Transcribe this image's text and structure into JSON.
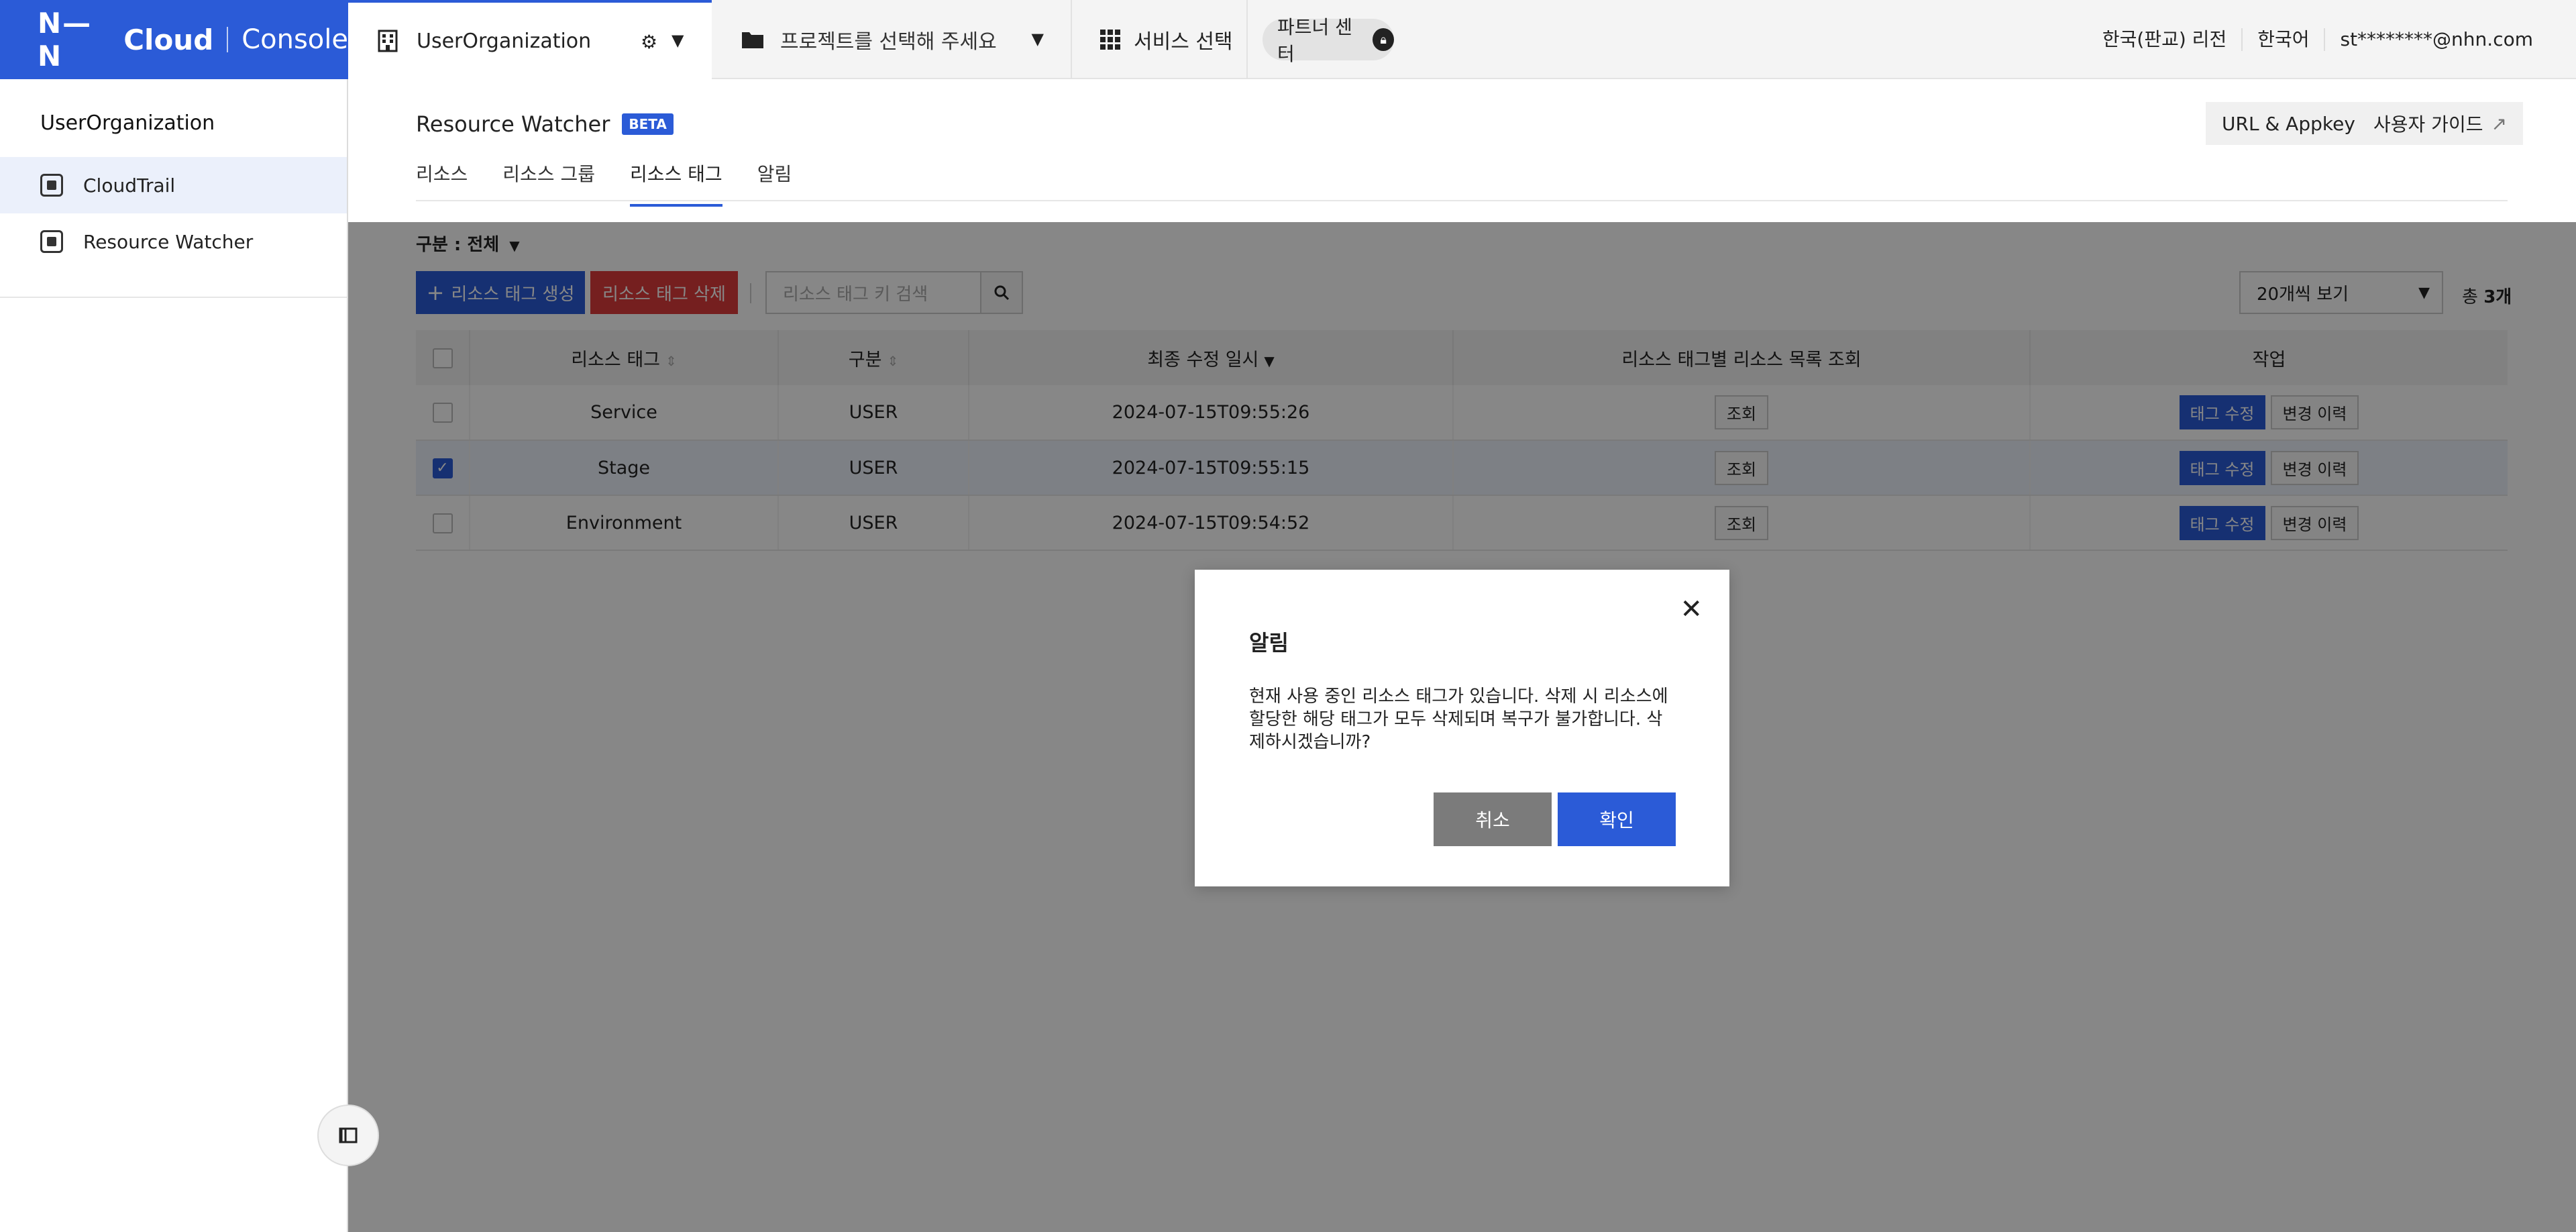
{
  "header": {
    "logo_nhn": "N—N",
    "logo_cloud": "Cloud",
    "logo_console": "Console",
    "organization": "UserOrganization",
    "project_placeholder": "프로젝트를 선택해 주세요",
    "service_select": "서비스 선택",
    "partner_center": "파트너 센터",
    "region": "한국(판교) 리전",
    "language": "한국어",
    "account": "st********@nhn.com"
  },
  "sidebar": {
    "org_title": "UserOrganization",
    "items": [
      {
        "label": "CloudTrail",
        "active": true
      },
      {
        "label": "Resource Watcher",
        "active": false
      }
    ]
  },
  "main": {
    "title": "Resource Watcher",
    "badge": "BETA",
    "url_appkey": "URL & Appkey",
    "user_guide": "사용자 가이드",
    "tabs": [
      {
        "label": "리소스"
      },
      {
        "label": "리소스 그룹"
      },
      {
        "label": "리소스 태그"
      },
      {
        "label": "알림"
      }
    ],
    "filter": "구분 : 전체",
    "create_button": "리소스 태그 생성",
    "delete_button": "리소스 태그 삭제",
    "search_placeholder": "리소스 태그 키 검색",
    "per_page": "20개씩 보기",
    "total_prefix": "총",
    "total_count": "3개",
    "columns": {
      "tag": "리소스 태그",
      "type": "구분",
      "modified": "최종 수정 일시",
      "list": "리소스 태그별 리소스 목록 조회",
      "action": "작업"
    },
    "rows": [
      {
        "tag": "Service",
        "type": "USER",
        "modified": "2024-07-15T09:55:26",
        "view": "조회",
        "edit": "태그 수정",
        "history": "변경 이력",
        "checked": false
      },
      {
        "tag": "Stage",
        "type": "USER",
        "modified": "2024-07-15T09:55:15",
        "view": "조회",
        "edit": "태그 수정",
        "history": "변경 이력",
        "checked": true
      },
      {
        "tag": "Environment",
        "type": "USER",
        "modified": "2024-07-15T09:54:52",
        "view": "조회",
        "edit": "태그 수정",
        "history": "변경 이력",
        "checked": false
      }
    ]
  },
  "dialog": {
    "title": "알림",
    "message": "현재 사용 중인 리소스 태그가 있습니다. 삭제 시 리소스에 할당한 해당 태그가 모두 삭제되며 복구가 불가합니다. 삭제하시겠습니까?",
    "cancel": "취소",
    "confirm": "확인"
  },
  "colors": {
    "accent": "#2b5bd7",
    "danger": "#dd3b3b",
    "cancel": "#7b7b7b"
  }
}
